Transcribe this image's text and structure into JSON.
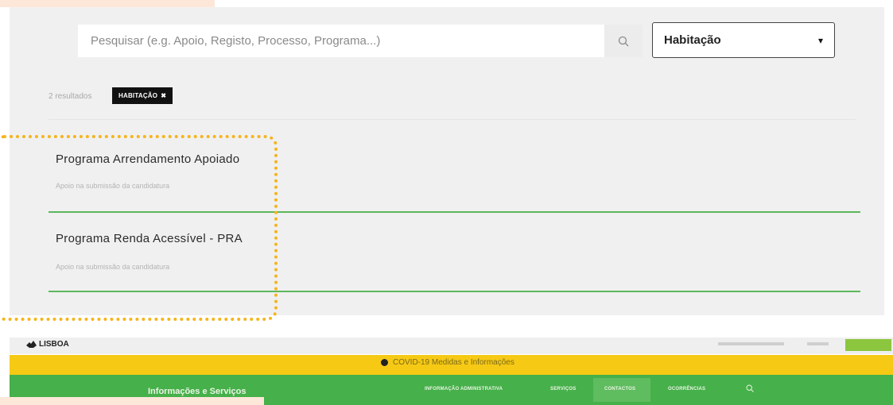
{
  "search": {
    "placeholder": "Pesquisar (e.g. Apoio, Registo, Processo, Programa...)"
  },
  "filter": {
    "selected": "Habitação",
    "caret": "▾"
  },
  "results": {
    "count_label": "2 resultados",
    "tag_label": "HABITAÇÃO",
    "tag_close": "✖",
    "items": [
      {
        "title": "Programa Arrendamento Apoiado",
        "subtitle": "Apoio na submissão da candidatura"
      },
      {
        "title": "Programa Renda Acessível - PRA",
        "subtitle": "Apoio na submissão da candidatura"
      }
    ]
  },
  "site_header": {
    "logo": "LISBOA",
    "covid_text": "COVID-19 Medidas e Informações",
    "nav_title": "Informações e Serviços",
    "nav_items": [
      "INFORMAÇÃO ADMINISTRATIVA",
      "SERVIÇOS",
      "CONTACTOS",
      "OCORRÊNCIAS"
    ]
  },
  "colors": {
    "accent_green": "#46b04a",
    "divider_green": "#5cb85c",
    "covid_yellow": "#f6c915",
    "highlight_orange": "#f6b41b",
    "tag_black": "#111111"
  },
  "icons": [
    "search-icon",
    "chevron-down-icon",
    "close-icon",
    "lisboa-logo-icon",
    "info-icon"
  ]
}
